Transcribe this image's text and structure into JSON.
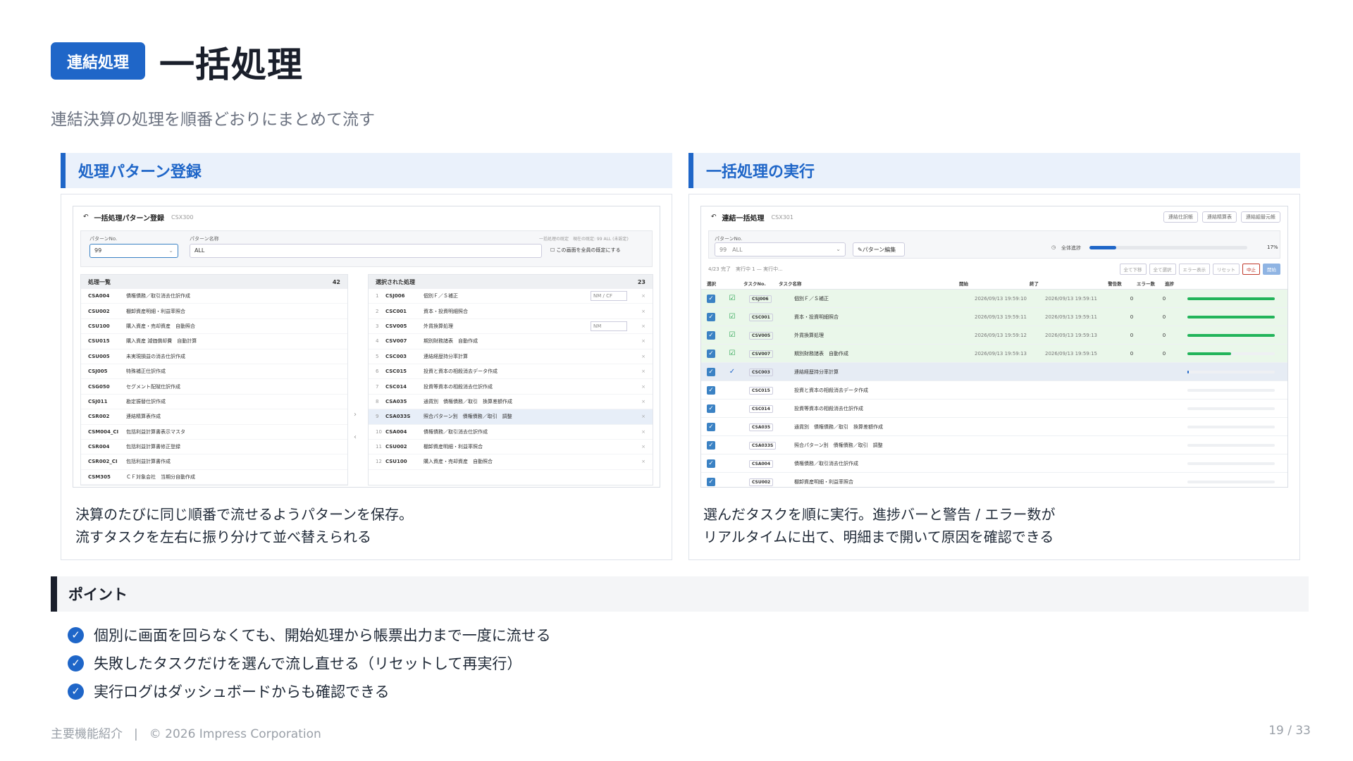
{
  "header": {
    "badge": "連結処理",
    "title": "一括処理",
    "subtitle": "連結決算の処理を順番どおりにまとめて流す"
  },
  "left_card": {
    "heading": "処理パターン登録",
    "desc": [
      "決算のたびに同じ順番で流せるようパターンを保存。",
      "流すタスクを左右に振り分けて並べ替えられる"
    ],
    "screen": {
      "title": "一括処理パターン登録",
      "code": "CSX300",
      "pattern_no_label": "パターンNo.",
      "pattern_no": "99",
      "pattern_name_label": "パターン名称",
      "pattern_name": "ALL",
      "default_note": "一括処理の既定　現在の既定: 99 ALL (未設定)",
      "default_check": "この画面を全員の既定にする",
      "list_title": "処理一覧",
      "list_count": "42",
      "list": [
        {
          "code": "CSA004",
          "name": "債権債務／取引消去仕訳作成"
        },
        {
          "code": "CSU002",
          "name": "棚卸資産明細・利益率照合"
        },
        {
          "code": "CSU100",
          "name": "購入資産・売却資産　自動照合"
        },
        {
          "code": "CSU015",
          "name": "購入資産 減価償却費　自動計算"
        },
        {
          "code": "CSU005",
          "name": "未実現損益の消去仕訳作成"
        },
        {
          "code": "CSJ005",
          "name": "特殊補正仕訳作成"
        },
        {
          "code": "CSG050",
          "name": "セグメント配賦仕訳作成"
        },
        {
          "code": "CSJ011",
          "name": "勘定振替仕訳作成"
        },
        {
          "code": "CSR002",
          "name": "連結精算表作成"
        },
        {
          "code": "CSM004_CI",
          "name": "包括利益計算書表示マスタ"
        },
        {
          "code": "CSR004",
          "name": "包括利益計算書修正登録"
        },
        {
          "code": "CSR002_CI",
          "name": "包括利益計算書作成"
        },
        {
          "code": "CSM305",
          "name": "ＣＦ対象会社　当期分自動作成"
        }
      ],
      "selected_title": "選択された処理",
      "selected_count": "23",
      "selected": [
        {
          "no": "1",
          "code": "CSJ006",
          "name": "個別Ｆ／Ｓ補正",
          "opt": "NM / CF"
        },
        {
          "no": "2",
          "code": "CSC001",
          "name": "資本・投資明細照合",
          "opt": ""
        },
        {
          "no": "3",
          "code": "CSV005",
          "name": "外貨換算処理",
          "opt": "NM"
        },
        {
          "no": "4",
          "code": "CSV007",
          "name": "期別財務諸表　自動作成",
          "opt": ""
        },
        {
          "no": "5",
          "code": "CSC003",
          "name": "連結経歴持分率計算",
          "opt": ""
        },
        {
          "no": "6",
          "code": "CSC015",
          "name": "投資と資本の相殺消去データ作成",
          "opt": ""
        },
        {
          "no": "7",
          "code": "CSC014",
          "name": "投資等資本の相殺消去仕訳作成",
          "opt": ""
        },
        {
          "no": "8",
          "code": "CSA035",
          "name": "通貨別　債権債務／取引　換算差額作成",
          "opt": ""
        },
        {
          "no": "9",
          "code": "CSA033S",
          "name": "照合パターン別　債権債務／取引　調整",
          "opt": ""
        },
        {
          "no": "10",
          "code": "CSA004",
          "name": "債権債務／取引消去仕訳作成",
          "opt": ""
        },
        {
          "no": "11",
          "code": "CSU002",
          "name": "棚卸資産明細・利益率照合",
          "opt": ""
        },
        {
          "no": "12",
          "code": "CSU100",
          "name": "購入資産・売却資産　自動照合",
          "opt": ""
        }
      ]
    }
  },
  "right_card": {
    "heading": "一括処理の実行",
    "desc": [
      "選んだタスクを順に実行。進捗バーと警告 / エラー数が",
      "リアルタイムに出て、明細まで開いて原因を確認できる"
    ],
    "screen": {
      "title": "連結一括処理",
      "code": "CSX301",
      "links": [
        "連結仕訳帳",
        "連結精算表",
        "連結組替元帳"
      ],
      "pattern_no_label": "パターンNo.",
      "pattern": "99　ALL",
      "edit_button": "パターン編集",
      "overall_label": "全体進捗",
      "overall_pct": "17%",
      "overall_frac": 0.17,
      "status": "4/23 完了　実行中 1 — 実行中...",
      "actions": [
        "全て下移",
        "全て選択",
        "エラー表示",
        "リセット",
        "中止",
        "開始"
      ],
      "columns": [
        "選択",
        "タスクNo.",
        "タスク名称",
        "開始",
        "終了",
        "警告数",
        "エラー数",
        "進捗"
      ],
      "rows": [
        {
          "code": "CSJ006",
          "name": "個別Ｆ／Ｓ補正",
          "start": "2026/09/13 19:59:10",
          "end": "2026/09/13 19:59:11",
          "warn": "0",
          "err": "0",
          "progress": 1.0,
          "state": "done"
        },
        {
          "code": "CSC001",
          "name": "資本・投資明細照合",
          "start": "2026/09/13 19:59:11",
          "end": "2026/09/13 19:59:11",
          "warn": "0",
          "err": "0",
          "progress": 1.0,
          "state": "done"
        },
        {
          "code": "CSV005",
          "name": "外貨換算処理",
          "start": "2026/09/13 19:59:12",
          "end": "2026/09/13 19:59:13",
          "warn": "0",
          "err": "0",
          "progress": 1.0,
          "state": "done"
        },
        {
          "code": "CSV007",
          "name": "期別財務諸表　自動作成",
          "start": "2026/09/13 19:59:13",
          "end": "2026/09/13 19:59:15",
          "warn": "0",
          "err": "0",
          "progress": 0.5,
          "state": "done"
        },
        {
          "code": "CSC003",
          "name": "連結経歴持分率計算",
          "start": "",
          "end": "",
          "warn": "",
          "err": "",
          "progress": 0.02,
          "state": "run"
        },
        {
          "code": "CSC015",
          "name": "投資と資本の相殺消去データ作成",
          "start": "",
          "end": "",
          "warn": "",
          "err": "",
          "progress": 0,
          "state": ""
        },
        {
          "code": "CSC014",
          "name": "投資等資本の相殺消去仕訳作成",
          "start": "",
          "end": "",
          "warn": "",
          "err": "",
          "progress": 0,
          "state": ""
        },
        {
          "code": "CSA035",
          "name": "通貨別　債権債務／取引　換算差額作成",
          "start": "",
          "end": "",
          "warn": "",
          "err": "",
          "progress": 0,
          "state": ""
        },
        {
          "code": "CSA033S",
          "name": "照合パターン別　債権債務／取引　調整",
          "start": "",
          "end": "",
          "warn": "",
          "err": "",
          "progress": 0,
          "state": ""
        },
        {
          "code": "CSA004",
          "name": "債権債務／取引消去仕訳作成",
          "start": "",
          "end": "",
          "warn": "",
          "err": "",
          "progress": 0,
          "state": ""
        },
        {
          "code": "CSU002",
          "name": "棚卸資産明細・利益率照合",
          "start": "",
          "end": "",
          "warn": "",
          "err": "",
          "progress": 0,
          "state": ""
        }
      ]
    }
  },
  "points": {
    "heading": "ポイント",
    "items": [
      "個別に画面を回らなくても、開始処理から帳票出力まで一度に流せる",
      "失敗したタスクだけを選んで流し直せる（リセットして再実行）",
      "実行ログはダッシュボードからも確認できる"
    ]
  },
  "footer": {
    "section": "主要機能紹介",
    "copyright": "© 2026 Impress Corporation",
    "page": "19 / 33"
  }
}
